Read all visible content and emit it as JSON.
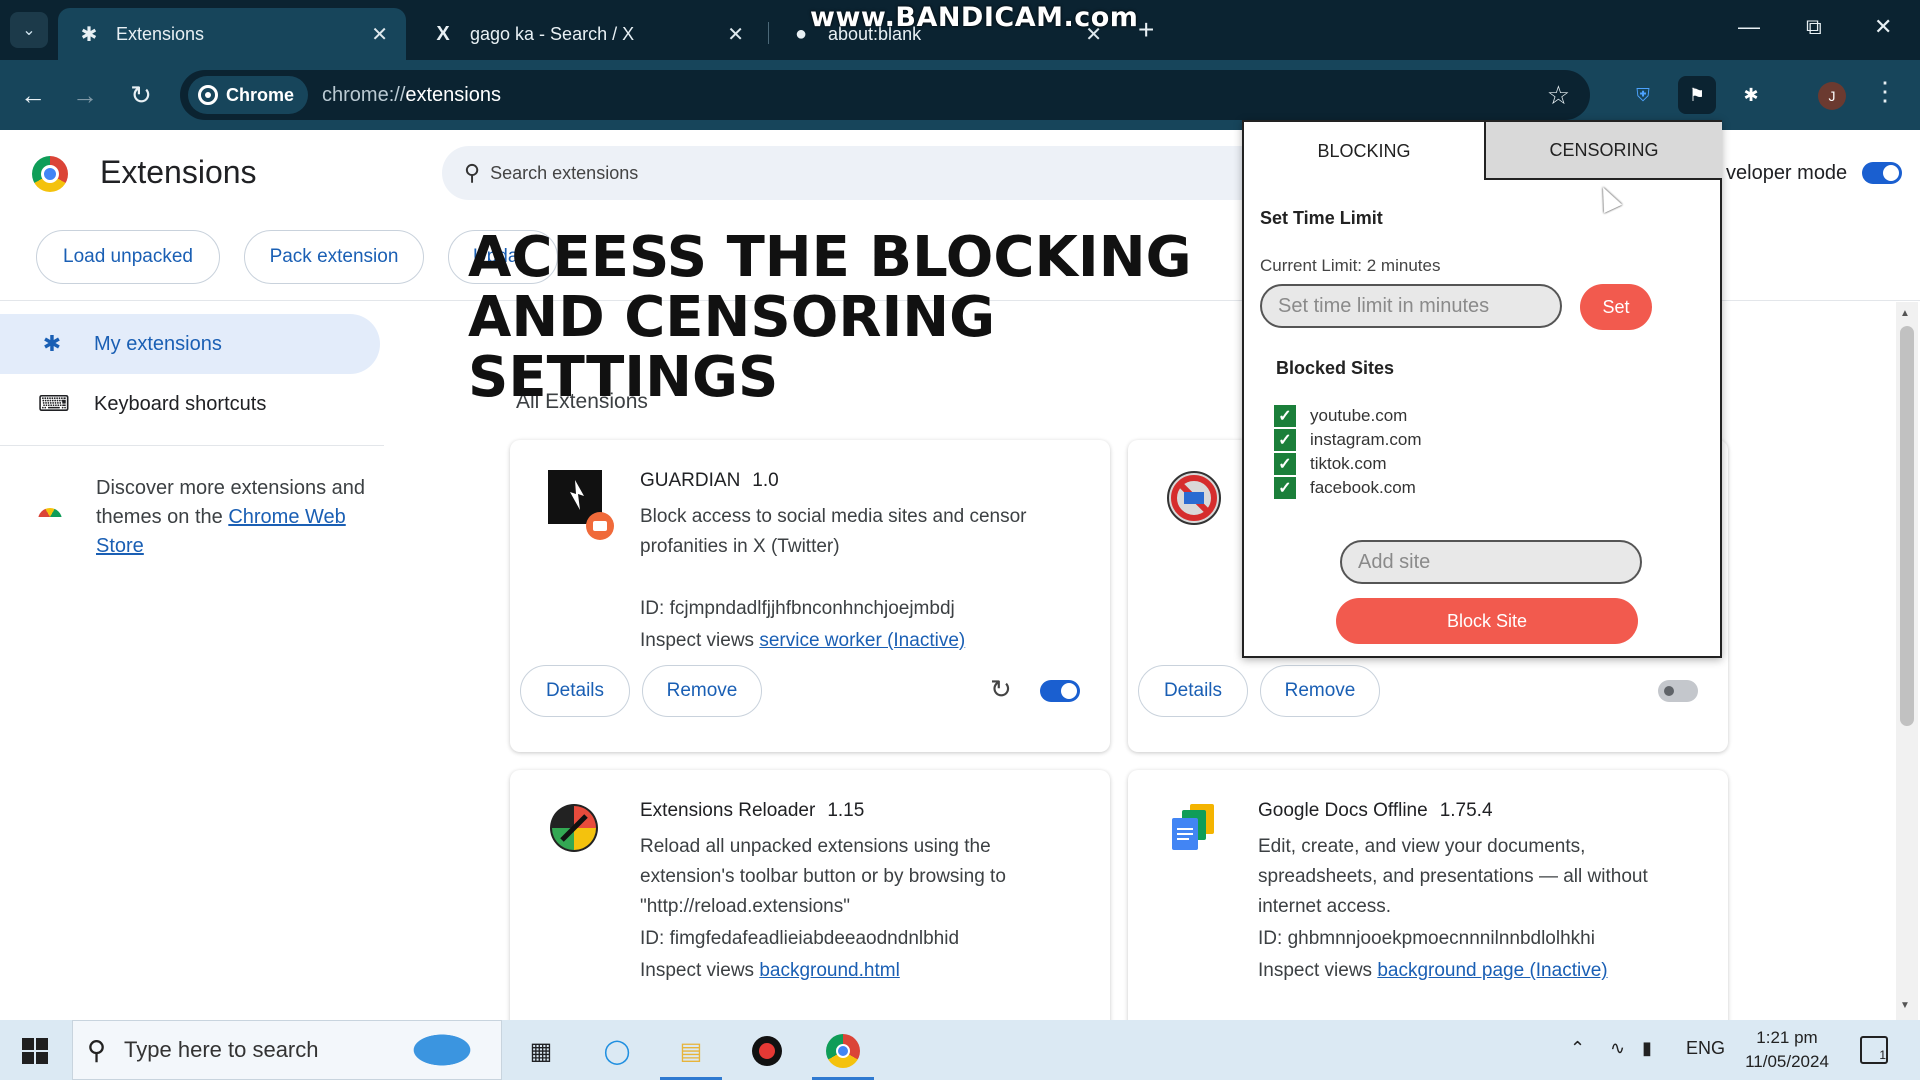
{
  "browser": {
    "tabs": [
      {
        "title": "Extensions",
        "icon": "puzzle-icon",
        "active": true
      },
      {
        "title": "gago ka - Search / X",
        "icon": "x-logo-icon",
        "active": false
      },
      {
        "title": "about:blank",
        "icon": "globe-icon",
        "active": false
      }
    ],
    "watermark": "www.BANDICAM.com",
    "chip_label": "Chrome",
    "url_scheme": "chrome://",
    "url_path": "extensions",
    "profile_initial": "J"
  },
  "header": {
    "title": "Extensions",
    "search_placeholder": "Search extensions",
    "dev_mode_label": "veloper mode",
    "dev_mode_on": true,
    "buttons": {
      "load_unpacked": "Load unpacked",
      "pack_extension": "Pack extension",
      "update": "Updat"
    }
  },
  "overlay_title": "ACEESS THE BLOCKING AND CENSORING SETTINGS",
  "sidebar": {
    "items": [
      {
        "label": "My extensions",
        "icon": "extension-icon",
        "selected": true
      },
      {
        "label": "Keyboard shortcuts",
        "icon": "keyboard-icon",
        "selected": false
      }
    ],
    "discover_text": "Discover more extensions and themes on the ",
    "webstore_link": "Chrome Web Store"
  },
  "main": {
    "section_title": "All Extensions",
    "details_label": "Details",
    "remove_label": "Remove",
    "inspect_label": "Inspect views",
    "id_prefix": "ID: ",
    "cards": [
      {
        "name": "GUARDIAN",
        "version": "1.0",
        "description": "Block access to social media sites and censor profanities in X (Twitter)",
        "id": "fcjmpndadlfjjhfbnconhnchjoejmbdj",
        "inspect_link": "service worker (Inactive)",
        "enabled": true
      },
      {
        "name": "",
        "version": "",
        "description": "",
        "id": "",
        "inspect_link": "",
        "enabled": false
      },
      {
        "name": "Extensions Reloader",
        "version": "1.15",
        "description": "Reload all unpacked extensions using the extension's toolbar button or by browsing to \"http://reload.extensions\"",
        "id": "fimgfedafeadlieiabdeeaodndnlbhid",
        "inspect_link": "background.html"
      },
      {
        "name": "Google Docs Offline",
        "version": "1.75.4",
        "description": "Edit, create, and view your documents, spreadsheets, and presentations — all without internet access.",
        "id": "ghbmnnjooekpmoecnnnilnnbdlolhkhi",
        "inspect_link": "background page (Inactive)"
      }
    ]
  },
  "popup": {
    "tabs": {
      "blocking": "BLOCKING",
      "censoring": "CENSORING"
    },
    "active_tab": "BLOCKING",
    "set_time_limit_title": "Set Time Limit",
    "current_limit": "Current Limit: 2 minutes",
    "time_placeholder": "Set time limit in minutes",
    "set_label": "Set",
    "blocked_sites_title": "Blocked Sites",
    "blocked_sites": [
      "youtube.com",
      "instagram.com",
      "tiktok.com",
      "facebook.com"
    ],
    "add_site_placeholder": "Add site",
    "block_site_label": "Block Site",
    "accent_color": "#f25a4e"
  },
  "taskbar": {
    "search_placeholder": "Type here to search",
    "language": "ENG",
    "time": "1:21 pm",
    "date": "11/05/2024",
    "notification_count": "1"
  }
}
